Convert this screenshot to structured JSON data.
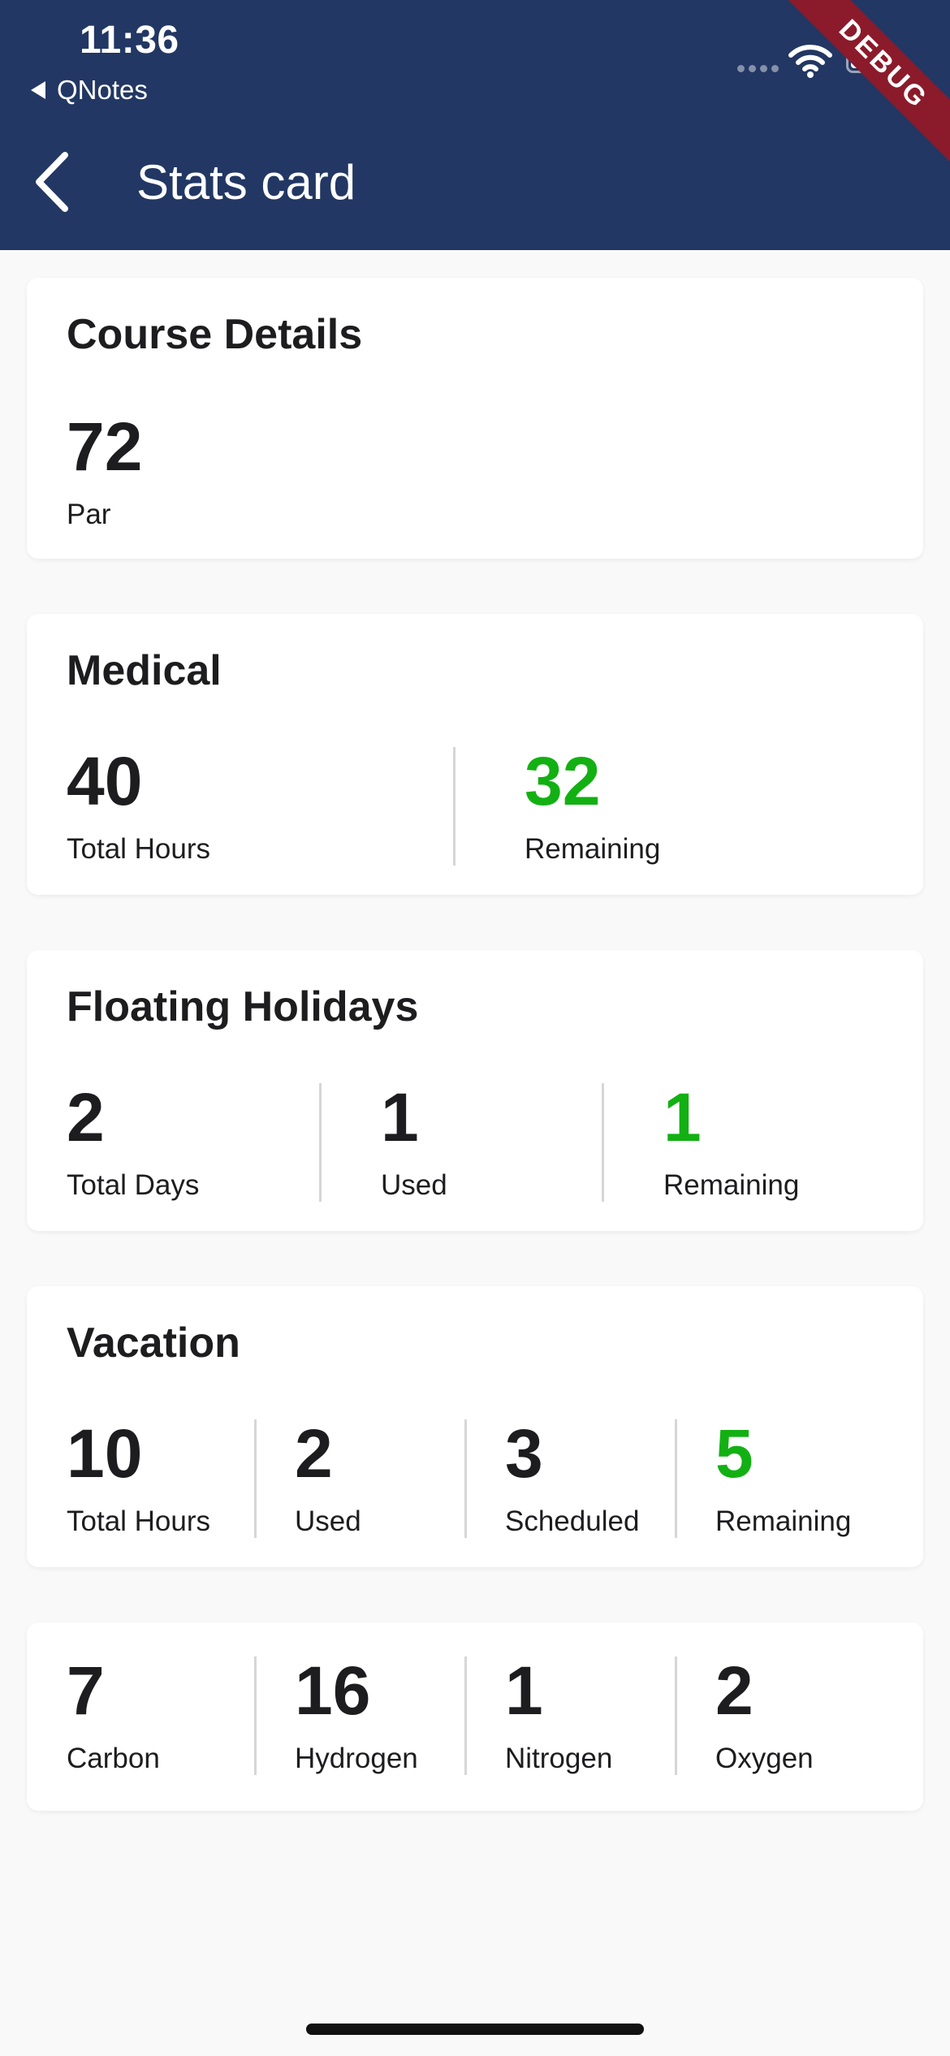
{
  "status_bar": {
    "time": "11:36",
    "back_app": "QNotes"
  },
  "debug_banner": "DEBUG",
  "appbar": {
    "title": "Stats card",
    "background": "#223763"
  },
  "colors": {
    "highlight_value": "#13b013",
    "card_background": "#ffffff",
    "page_background": "#f9f9f9"
  },
  "cards": {
    "course": {
      "title": "Course Details",
      "stats": [
        {
          "value": "72",
          "label": "Par"
        }
      ]
    },
    "medical": {
      "title": "Medical",
      "stats": [
        {
          "value": "40",
          "label": "Total Hours"
        },
        {
          "value": "32",
          "label": "Remaining",
          "highlight": true
        }
      ]
    },
    "floating": {
      "title": "Floating Holidays",
      "stats": [
        {
          "value": "2",
          "label": "Total Days"
        },
        {
          "value": "1",
          "label": "Used"
        },
        {
          "value": "1",
          "label": "Remaining",
          "highlight": true
        }
      ]
    },
    "vacation": {
      "title": "Vacation",
      "stats": [
        {
          "value": "10",
          "label": "Total Hours"
        },
        {
          "value": "2",
          "label": "Used"
        },
        {
          "value": "3",
          "label": "Scheduled"
        },
        {
          "value": "5",
          "label": "Remaining",
          "highlight": true
        }
      ]
    },
    "elements": {
      "stats": [
        {
          "value": "7",
          "label": "Carbon"
        },
        {
          "value": "16",
          "label": "Hydrogen"
        },
        {
          "value": "1",
          "label": "Nitrogen"
        },
        {
          "value": "2",
          "label": "Oxygen"
        }
      ]
    }
  }
}
